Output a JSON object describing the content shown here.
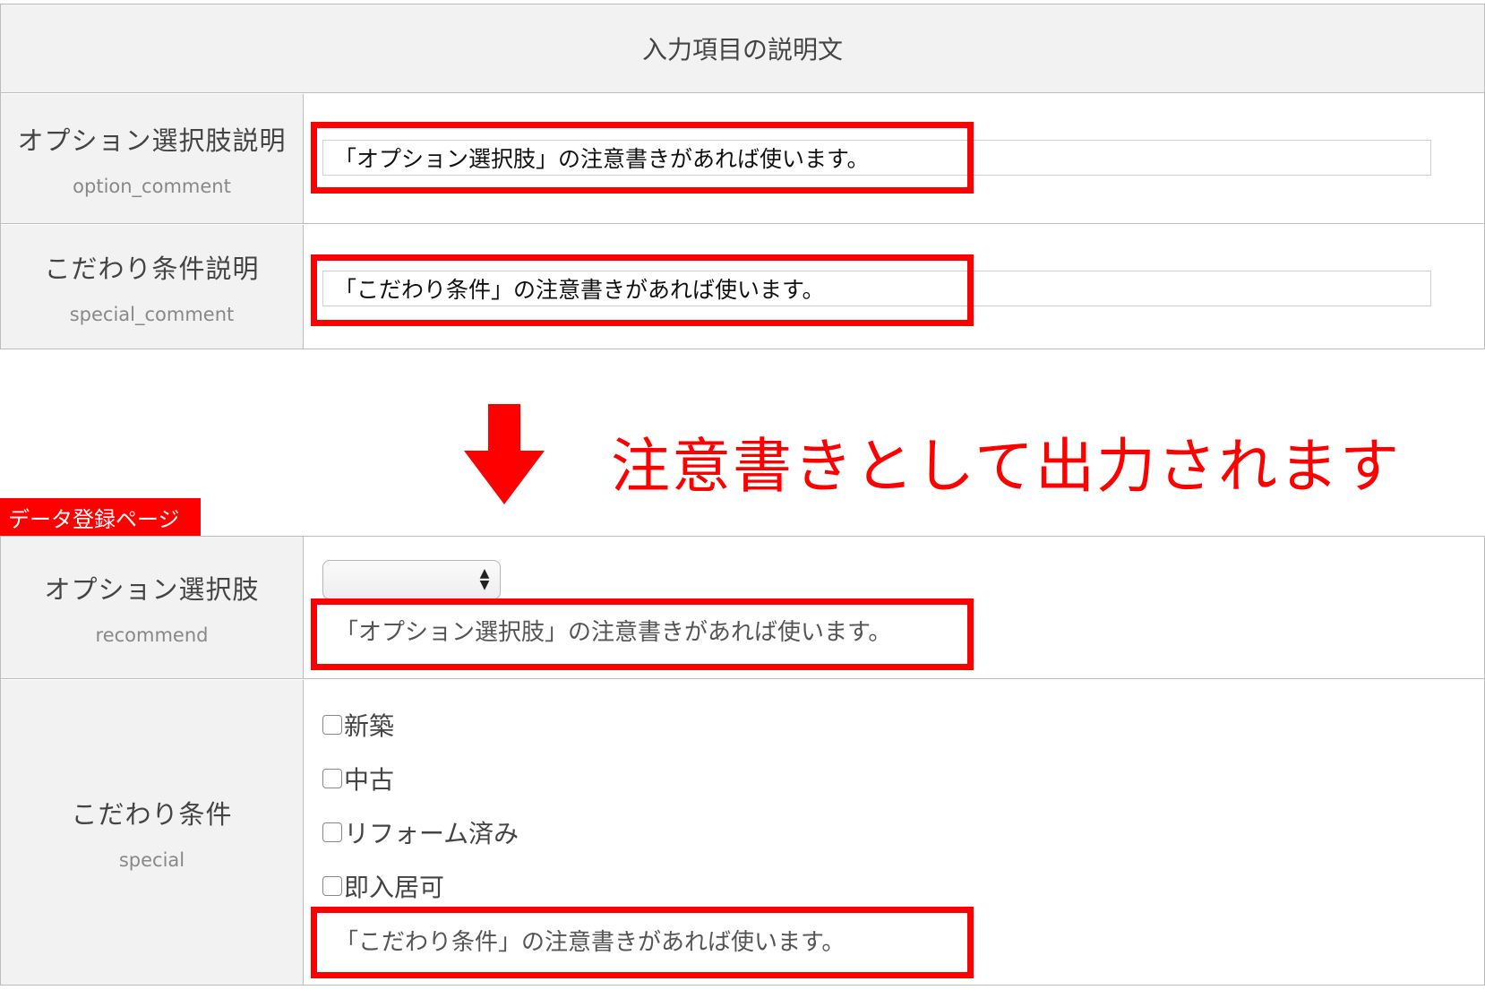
{
  "settings": {
    "header": "入力項目の説明文",
    "rows": [
      {
        "label": "オプション選択肢説明",
        "key": "option_comment",
        "value": "「オプション選択肢」の注意書きがあれば使います。"
      },
      {
        "label": "こだわり条件説明",
        "key": "special_comment",
        "value": "「こだわり条件」の注意書きがあれば使います。"
      }
    ]
  },
  "annotation": {
    "caption": "注意書きとして出力されます",
    "accent_color": "#ff0000",
    "arrow_icon": "arrow-down-icon"
  },
  "data_page": {
    "tag": "データ登録ページ",
    "option_field": {
      "label": "オプション選択肢",
      "key": "recommend",
      "selected": "",
      "note": "「オプション選択肢」の注意書きがあれば使います。"
    },
    "special_field": {
      "label": "こだわり条件",
      "key": "special",
      "options": [
        "新築",
        "中古",
        "リフォーム済み",
        "即入居可"
      ],
      "note": "「こだわり条件」の注意書きがあれば使います。"
    }
  }
}
